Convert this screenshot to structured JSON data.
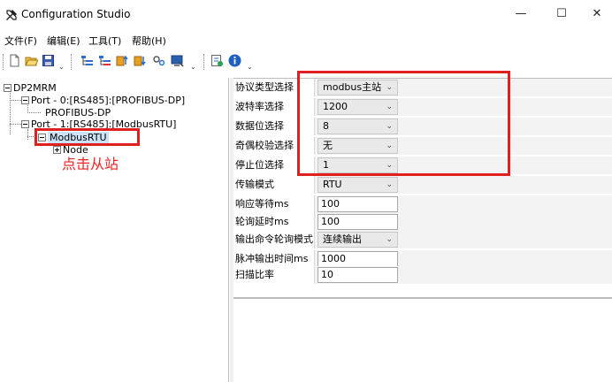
{
  "window": {
    "title": "Configuration Studio",
    "icon": "tools-icon",
    "controls": {
      "minimize": "—",
      "maximize": "☐",
      "close": "✕"
    }
  },
  "menu": [
    "文件(F)",
    "编辑(E)",
    "工具(T)",
    "帮助(H)"
  ],
  "toolbar": {
    "icons": [
      "new-file-icon",
      "open-folder-icon",
      "save-icon",
      "add-port-icon",
      "delete-icon",
      "upload-icon",
      "download-icon",
      "settings-icon",
      "monitor-icon",
      "run-icon",
      "info-icon"
    ]
  },
  "tree": {
    "root": "DP2MRM",
    "port0": "Port - 0:[RS485]:[PROFIBUS-DP]",
    "port0_child": "PROFIBUS-DP",
    "port1": "Port - 1:[RS485]:[ModbusRTU]",
    "port1_child": "ModbusRTU",
    "node": "Node"
  },
  "annotation": {
    "text": "点击从站",
    "color": "#ee2222"
  },
  "properties": [
    {
      "label": "协议类型选择",
      "value": "modbus主站",
      "type": "combo"
    },
    {
      "label": "波特率选择",
      "value": "1200",
      "type": "combo"
    },
    {
      "label": "数据位选择",
      "value": "8",
      "type": "combo"
    },
    {
      "label": "奇偶校验选择",
      "value": "无",
      "type": "combo"
    },
    {
      "label": "停止位选择",
      "value": "1",
      "type": "combo"
    },
    {
      "label": "传输模式",
      "value": "RTU",
      "type": "combo"
    },
    {
      "label": "响应等待ms",
      "value": "100",
      "type": "text"
    },
    {
      "label": "轮询延时ms",
      "value": "100",
      "type": "text"
    },
    {
      "label": "输出命令轮询模式",
      "value": "连续输出",
      "type": "combo"
    },
    {
      "label": "脉冲输出时间ms",
      "value": "1000",
      "type": "text"
    },
    {
      "label": "扫描比率",
      "value": "10",
      "type": "text"
    }
  ],
  "colors": {
    "highlight": "#e02020",
    "selected": "#cce3f7"
  }
}
